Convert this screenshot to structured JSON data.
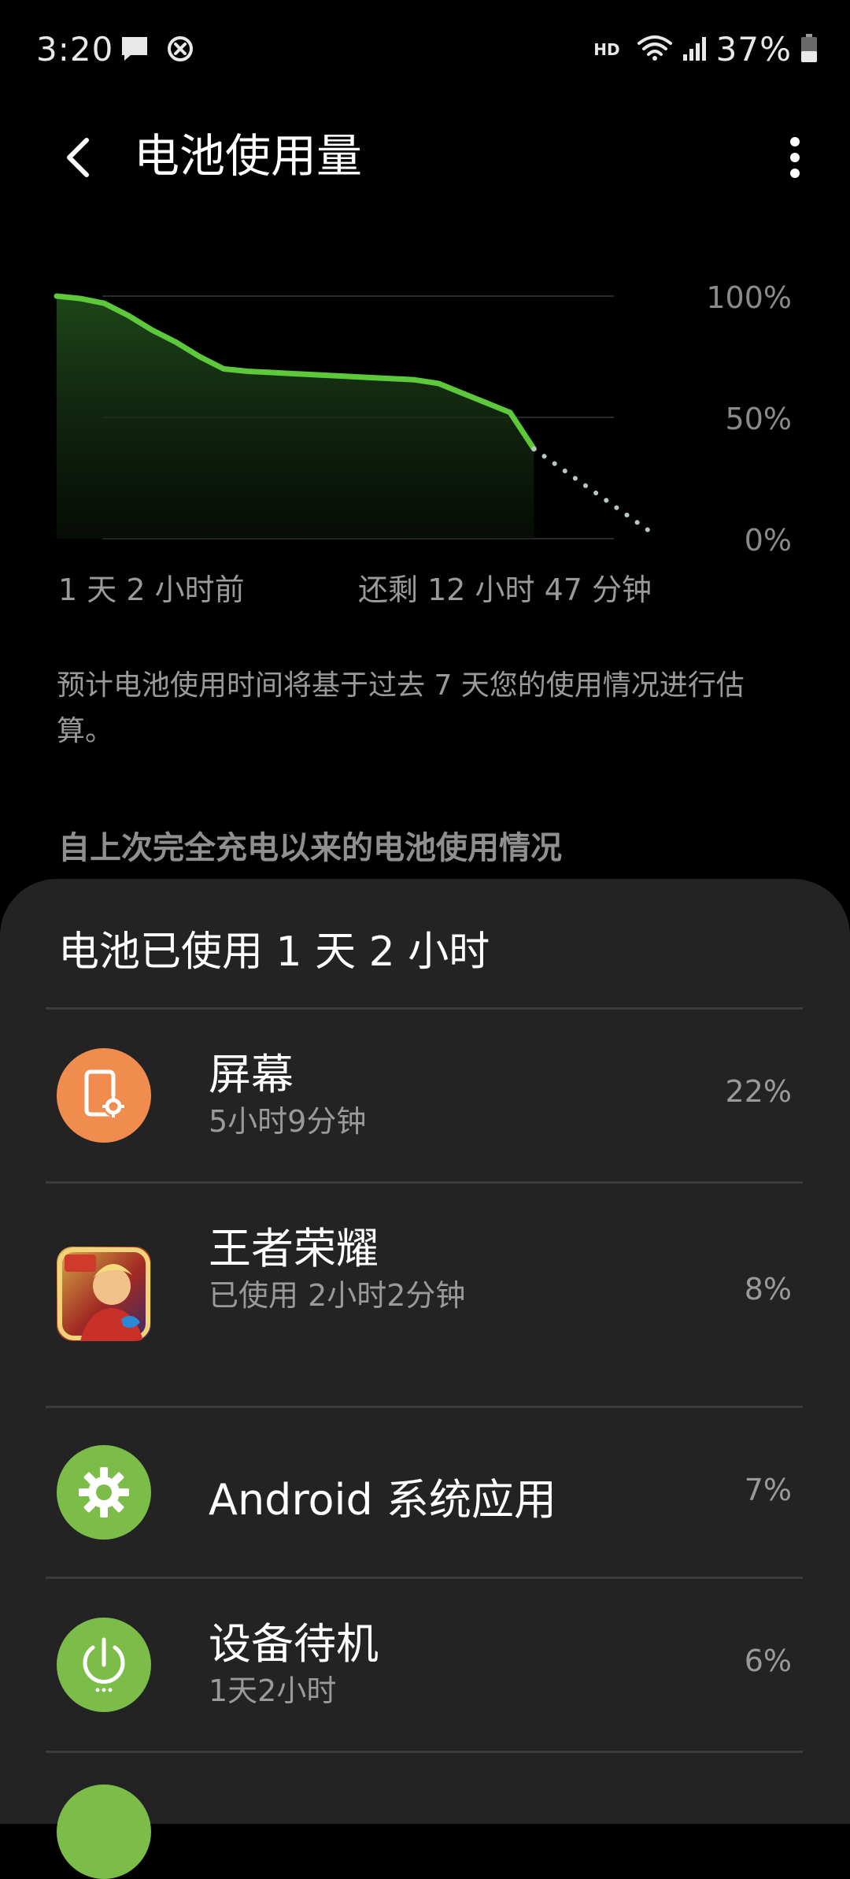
{
  "status_bar": {
    "time": "3:20",
    "hd": "HD",
    "battery_percent": "37%",
    "icons": [
      "message-icon",
      "blocked-icon",
      "wifi-icon",
      "signal-icon",
      "battery-icon"
    ]
  },
  "header": {
    "title": "电池使用量"
  },
  "chart_data": {
    "type": "line",
    "y_tick_labels": [
      "100%",
      "50%",
      "0%"
    ],
    "ylim": [
      0,
      100
    ],
    "x_start_label": "1 天 2 小时前",
    "x_end_label": "还剩 12 小时 47 分钟",
    "series": [
      {
        "style": "solid",
        "color": "#5cc83a",
        "values": [
          100,
          99,
          97,
          92,
          86,
          81,
          75,
          70,
          69,
          68.5,
          68,
          67.5,
          67,
          66.5,
          66,
          65.5,
          64,
          60,
          56,
          52,
          37
        ]
      },
      {
        "style": "dotted",
        "color": "#b7c7c9",
        "values": [
          37,
          30,
          23,
          16,
          9,
          2
        ]
      }
    ]
  },
  "estimate_note": "预计电池使用时间将基于过去 7 天您的使用情况进行估算。",
  "section_heading": "自上次完全充电以来的电池使用情况",
  "usage": {
    "summary": "电池已使用 1 天 2 小时",
    "apps": [
      {
        "name": "屏幕",
        "detail": "5小时9分钟",
        "percent": "22%",
        "icon": "screen-settings-icon",
        "color": "#f08c4e"
      },
      {
        "name": "王者荣耀",
        "detail": "已使用 2小时2分钟",
        "percent": "8%",
        "icon": "game-app-icon",
        "color": "#c9a23a"
      },
      {
        "name": "Android 系统应用",
        "detail": "",
        "percent": "7%",
        "icon": "gear-icon",
        "color": "#7cbd4a"
      },
      {
        "name": "设备待机",
        "detail": "1天2小时",
        "percent": "6%",
        "icon": "power-icon",
        "color": "#7cbd4a"
      }
    ]
  }
}
